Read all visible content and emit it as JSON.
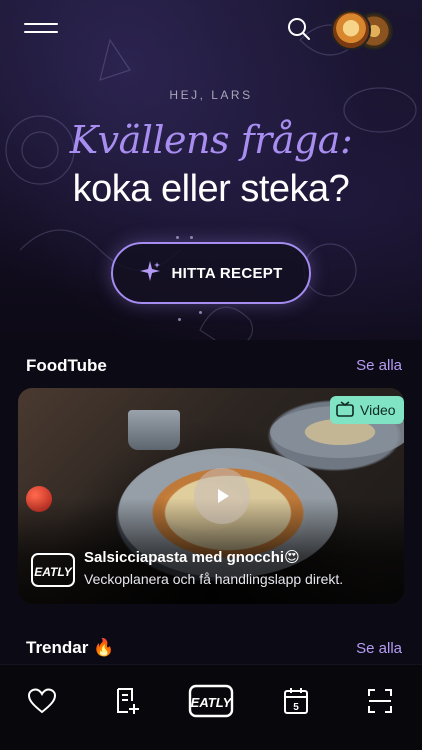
{
  "topbar": {
    "menu_icon": "hamburger-menu-icon",
    "search_icon": "search-icon",
    "avatars": [
      "avatar-1",
      "avatar-2"
    ]
  },
  "hero": {
    "greeting": "HEJ, LARS",
    "headline_line1": "Kvällens fråga:",
    "headline_line2": "koka eller steka?",
    "cta_label": "HITTA RECEPT",
    "cta_icon": "sparkle-icon"
  },
  "foodtube": {
    "title": "FoodTube",
    "see_all": "Se alla",
    "card": {
      "badge": "Video",
      "badge_icon": "tv-icon",
      "play_icon": "play-icon",
      "title": "Salsicciapasta med gnocchi😍",
      "subtitle": "Veckoplanera och få handlingslapp direkt.",
      "logo_text": "EATLY"
    }
  },
  "trends": {
    "title": "Trendar 🔥",
    "see_all": "Se alla"
  },
  "bottom_nav": {
    "items": [
      {
        "icon": "heart-icon"
      },
      {
        "icon": "recipe-list-add-icon"
      },
      {
        "icon": "eatly-logo-icon",
        "label": "EATLY"
      },
      {
        "icon": "calendar-icon",
        "label": "5"
      },
      {
        "icon": "scan-icon"
      }
    ]
  },
  "colors": {
    "accent": "#a88ef0",
    "link": "#b59cf5",
    "badge": "#7fe3c4",
    "background": "#0c0a14"
  }
}
